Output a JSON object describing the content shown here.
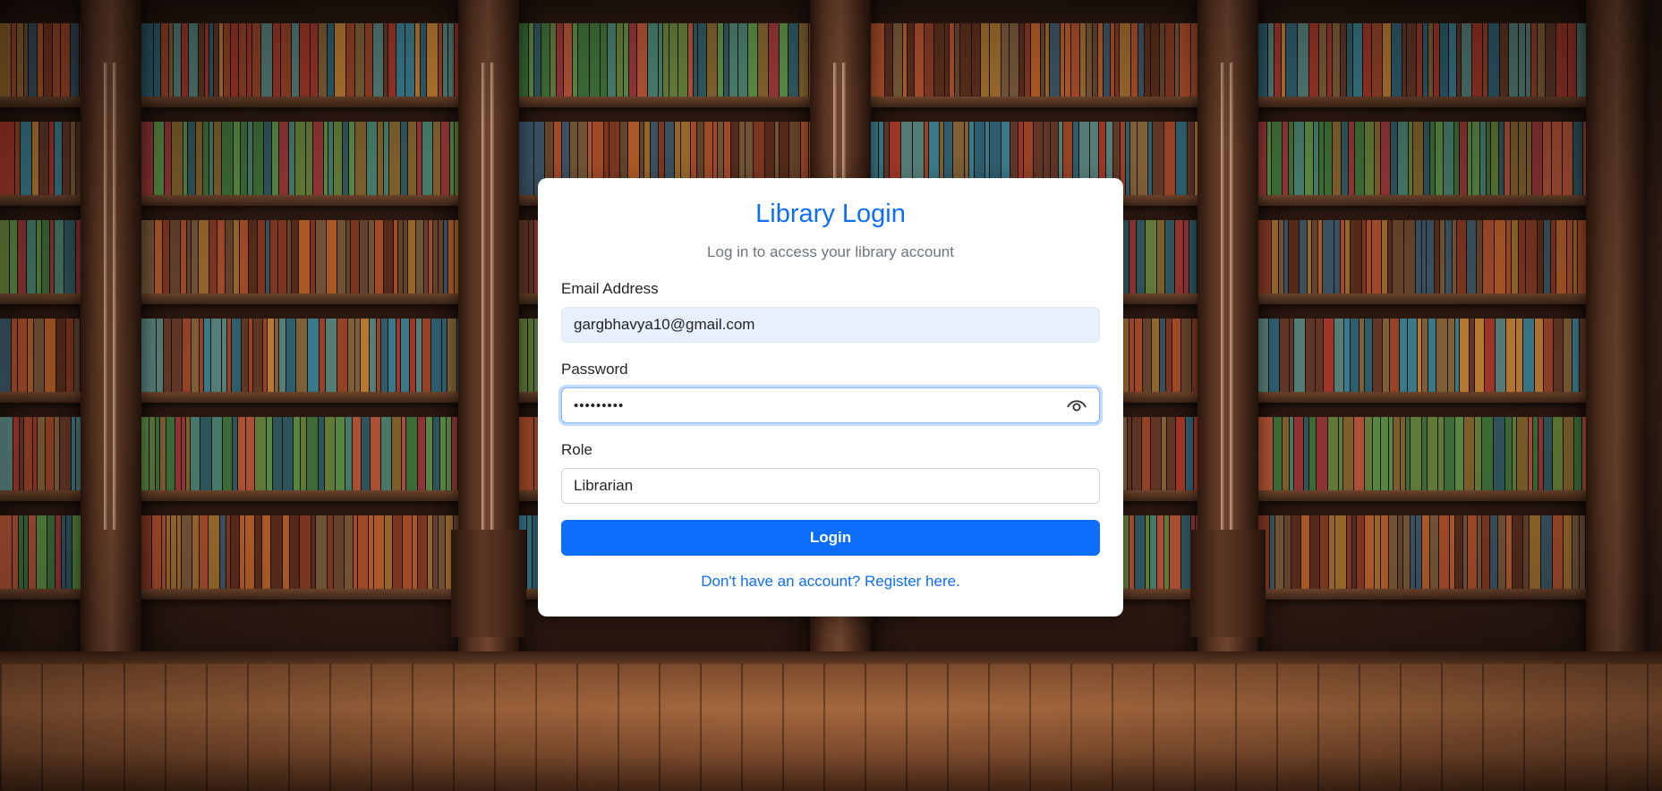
{
  "login": {
    "title": "Library Login",
    "subtitle": "Log in to access your library account",
    "email_label": "Email Address",
    "email_value": "gargbhavya10@gmail.com",
    "password_label": "Password",
    "password_masked": "•••••••••",
    "role_label": "Role",
    "role_value": "Librarian",
    "login_button": "Login",
    "register_link": "Don't have an account? Register here."
  },
  "icons": {
    "password_toggle": "eye-icon"
  },
  "colors": {
    "accent": "#0d6efd",
    "autofill_bg": "#e8f0fe",
    "muted_text": "#6c757d"
  }
}
